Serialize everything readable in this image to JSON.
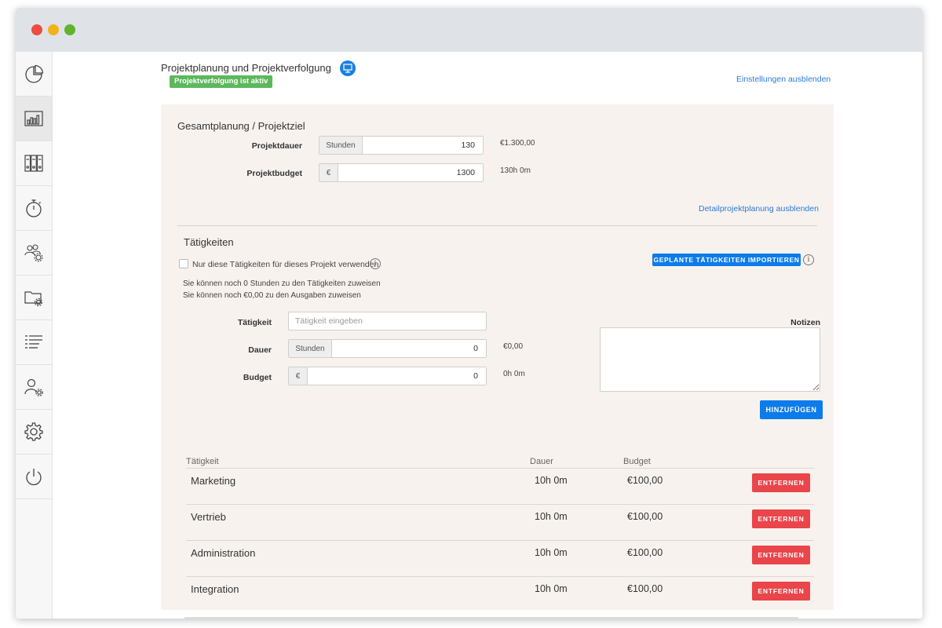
{
  "colors": {
    "accent": "#0d7bea",
    "status_green": "#5cb85c",
    "danger": "#e9454a",
    "panel_bg": "#f8f2ee"
  },
  "sidebar": {
    "items": [
      {
        "name": "sidebar-item-dashboard",
        "icon": "pie-chart-icon"
      },
      {
        "name": "sidebar-item-reports",
        "icon": "bar-chart-icon",
        "active": true
      },
      {
        "name": "sidebar-item-archive",
        "icon": "binders-icon"
      },
      {
        "name": "sidebar-item-timer",
        "icon": "stopwatch-icon"
      },
      {
        "name": "sidebar-item-team-settings",
        "icon": "team-gear-icon"
      },
      {
        "name": "sidebar-item-project-settings",
        "icon": "folder-gear-icon"
      },
      {
        "name": "sidebar-item-list",
        "icon": "list-icon"
      },
      {
        "name": "sidebar-item-user-settings",
        "icon": "user-gear-icon"
      },
      {
        "name": "sidebar-item-settings",
        "icon": "gear-icon"
      },
      {
        "name": "sidebar-item-logout",
        "icon": "power-icon"
      }
    ]
  },
  "header": {
    "title": "Projektplanung und Projektverfolgung",
    "status_badge": "Projektverfolgung ist aktiv",
    "toggle_settings_link": "Einstellungen ausblenden"
  },
  "overall": {
    "title": "Gesamtplanung / Projektziel",
    "duration_label": "Projektdauer",
    "duration_addon": "Stunden",
    "duration_value": "130",
    "duration_hint": "€1.300,00",
    "budget_label": "Projektbudget",
    "budget_addon": "€",
    "budget_value": "1300",
    "budget_hint": "130h 0m",
    "toggle_detail_link": "Detailprojektplanung ausblenden"
  },
  "activities": {
    "title": "Tätigkeiten",
    "checkbox_label": "Nur diese Tätigkeiten für dieses Projekt verwenden",
    "import_button": "GEPLANTE TÄTIGKEITEN IMPORTIEREN",
    "remaining_hours_text": "Sie können noch 0 Stunden zu den Tätigkeiten zuweisen",
    "remaining_budget_text": "Sie können noch €0,00 zu den Ausgaben zuweisen",
    "activity_label": "Tätigkeit",
    "activity_placeholder": "Tätigkeit eingeben",
    "duration_label": "Dauer",
    "duration_addon": "Stunden",
    "duration_value": "0",
    "duration_hint": "€0,00",
    "budget_label": "Budget",
    "budget_addon": "€",
    "budget_value": "0",
    "budget_hint": "0h 0m",
    "notes_label": "Notizen",
    "add_button": "HINZUFÜGEN"
  },
  "table": {
    "headers": {
      "activity": "Tätigkeit",
      "duration": "Dauer",
      "budget": "Budget"
    },
    "remove_label": "ENTFERNEN",
    "rows": [
      {
        "name": "Marketing",
        "duration": "10h 0m",
        "budget": "€100,00"
      },
      {
        "name": "Vertrieb",
        "duration": "10h 0m",
        "budget": "€100,00"
      },
      {
        "name": "Administration",
        "duration": "10h 0m",
        "budget": "€100,00"
      },
      {
        "name": "Integration",
        "duration": "10h 0m",
        "budget": "€100,00"
      }
    ]
  }
}
